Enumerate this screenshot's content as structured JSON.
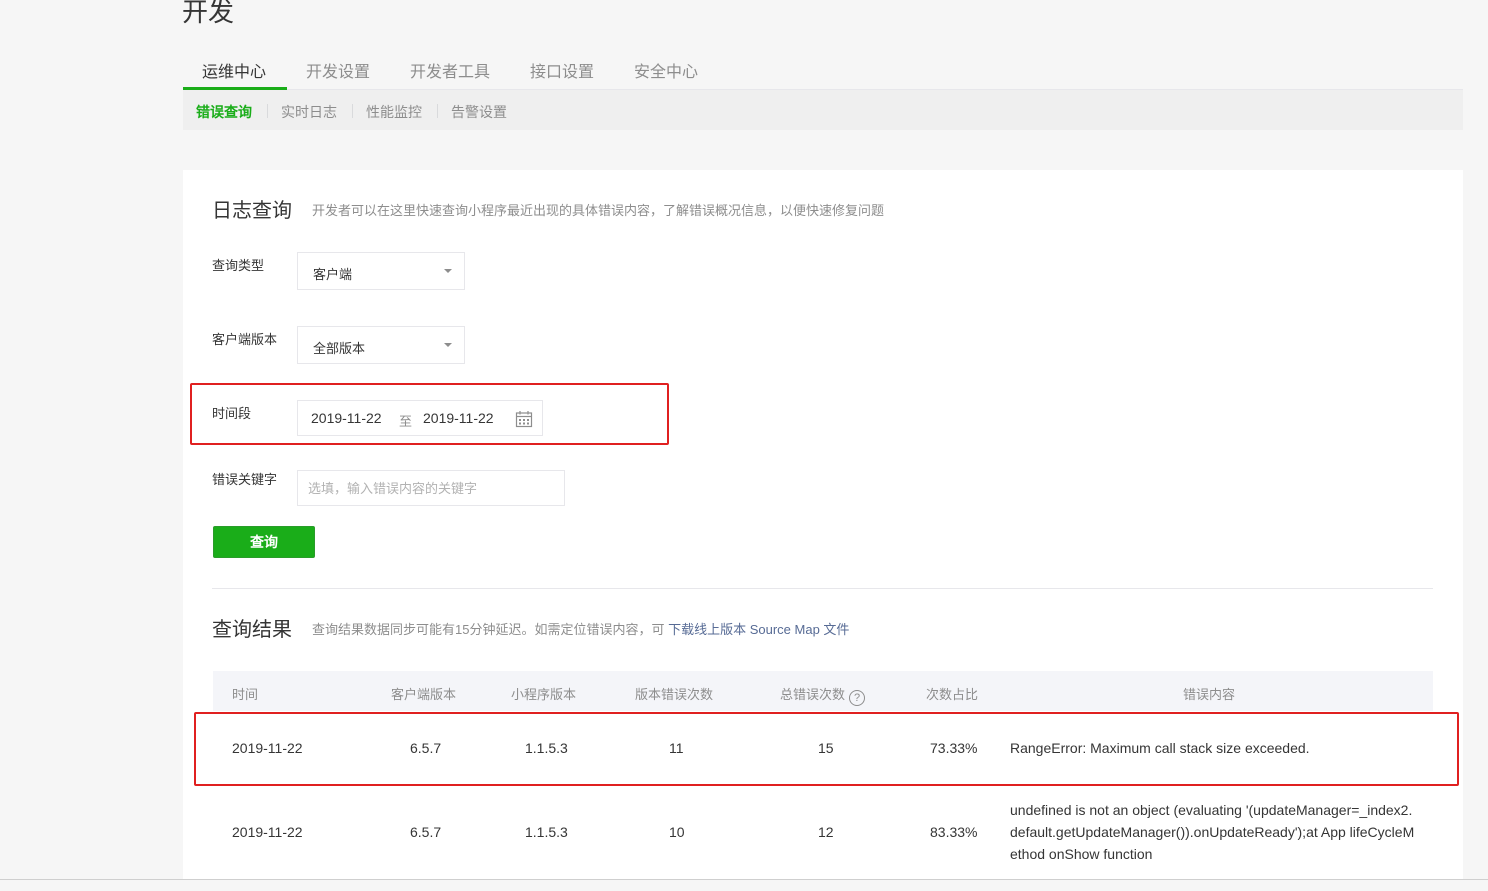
{
  "page": {
    "title": "开发"
  },
  "tabs": [
    {
      "label": "运维中心",
      "active": true
    },
    {
      "label": "开发设置",
      "active": false
    },
    {
      "label": "开发者工具",
      "active": false
    },
    {
      "label": "接口设置",
      "active": false
    },
    {
      "label": "安全中心",
      "active": false
    }
  ],
  "subtabs": [
    {
      "label": "错误查询",
      "active": true
    },
    {
      "label": "实时日志",
      "active": false
    },
    {
      "label": "性能监控",
      "active": false
    },
    {
      "label": "告警设置",
      "active": false
    }
  ],
  "log_query": {
    "title": "日志查询",
    "description": "开发者可以在这里快速查询小程序最近出现的具体错误内容，了解错误概况信息，以便快速修复问题",
    "query_type": {
      "label": "查询类型",
      "value": "客户端"
    },
    "client_version": {
      "label": "客户端版本",
      "value": "全部版本"
    },
    "time_range": {
      "label": "时间段",
      "start": "2019-11-22",
      "separator": "至",
      "end": "2019-11-22"
    },
    "keyword": {
      "label": "错误关键字",
      "placeholder": "选填，输入错误内容的关键字",
      "value": ""
    },
    "submit_label": "查询"
  },
  "results": {
    "title": "查询结果",
    "description": "查询结果数据同步可能有15分钟延迟。如需定位错误内容，可",
    "link_text": "下载线上版本 Source Map 文件",
    "columns": {
      "time": "时间",
      "client_version": "客户端版本",
      "app_version": "小程序版本",
      "version_errors": "版本错误次数",
      "total_errors": "总错误次数",
      "ratio": "次数占比",
      "content": "错误内容"
    },
    "help_glyph": "?",
    "rows": [
      {
        "time": "2019-11-22",
        "client_version": "6.5.7",
        "app_version": "1.1.5.3",
        "version_errors": "11",
        "total_errors": "15",
        "ratio": "73.33%",
        "content": "RangeError: Maximum call stack size exceeded."
      },
      {
        "time": "2019-11-22",
        "client_version": "6.5.7",
        "app_version": "1.1.5.3",
        "version_errors": "10",
        "total_errors": "12",
        "ratio": "83.33%",
        "content": "undefined is not an object (evaluating '(updateManager=_index2.default.getUpdateManager()).onUpdateReady');at App lifeCycleMethod onShow function"
      }
    ]
  },
  "colors": {
    "accent": "#1aad19",
    "highlight": "#e02020",
    "link": "#576b95"
  }
}
